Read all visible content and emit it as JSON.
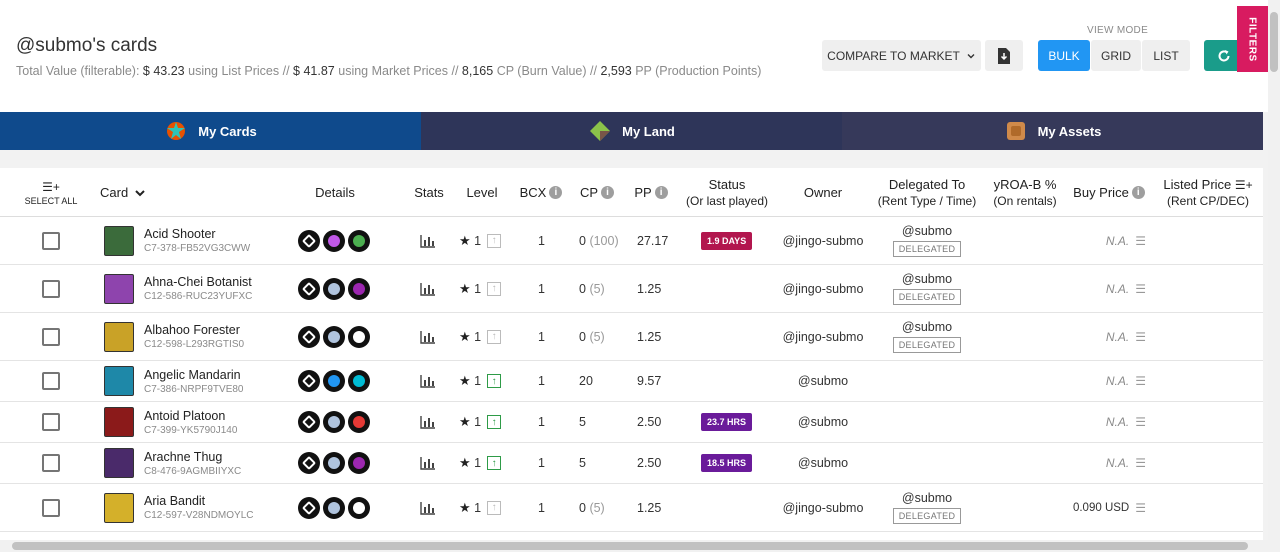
{
  "header": {
    "title": "@submo's cards",
    "summary": {
      "prefix": "Total Value (filterable):",
      "list_value": "$ 43.23",
      "list_suffix": "using List Prices //",
      "market_value": "$ 41.87",
      "market_suffix": "using Market Prices //",
      "cp_value": "8,165",
      "cp_suffix": "CP (Burn Value) //",
      "pp_value": "2,593",
      "pp_suffix": "PP (Production Points)"
    },
    "compare_label": "COMPARE TO MARKET",
    "view_mode_label": "VIEW MODE",
    "view_modes": [
      "BULK",
      "GRID",
      "LIST"
    ],
    "active_view_mode": "BULK",
    "filters_label": "FILTERS"
  },
  "tabs": [
    {
      "label": "My Cards",
      "icon": "cards-icon",
      "active": true
    },
    {
      "label": "My Land",
      "icon": "land-icon",
      "active": false
    },
    {
      "label": "My Assets",
      "icon": "assets-icon",
      "active": false
    }
  ],
  "table": {
    "select_all_label": "SELECT ALL",
    "columns": {
      "card": "Card",
      "details": "Details",
      "stats": "Stats",
      "level": "Level",
      "bcx": "BCX",
      "cp": "CP",
      "pp": "PP",
      "status": "Status",
      "status_sub": "(Or last played)",
      "owner": "Owner",
      "delegated": "Delegated To",
      "delegated_sub": "(Rent Type / Time)",
      "yroa": "yROA-B %",
      "yroa_sub": "(On rentals)",
      "buy_price": "Buy Price",
      "listed_price": "Listed Price",
      "listed_price_sub": "(Rent CP/DEC)"
    },
    "rows": [
      {
        "name": "Acid Shooter",
        "id": "C7-378-FB52VG3CWW",
        "level": "1",
        "bcx": "1",
        "cp": "0",
        "cp_extra": "(100)",
        "pp": "27.17",
        "status": "1.9 DAYS",
        "status_color": "red",
        "owner": "@jingo-submo",
        "delegated_to": "@submo",
        "delegated_label": "DELEGATED",
        "buy_price": "N.A.",
        "listed": "",
        "colors": [
          "#111",
          "#c158e8",
          "#4caf50"
        ],
        "thumb": "#3b6b3b",
        "upgradable": false
      },
      {
        "name": "Ahna-Chei Botanist",
        "id": "C12-586-RUC23YUFXC",
        "level": "1",
        "bcx": "1",
        "cp": "0",
        "cp_extra": "(5)",
        "pp": "1.25",
        "status": "",
        "status_color": "",
        "owner": "@jingo-submo",
        "delegated_to": "@submo",
        "delegated_label": "DELEGATED",
        "buy_price": "N.A.",
        "listed": "",
        "colors": [
          "#111",
          "#b0c4de",
          "#9c27b0"
        ],
        "thumb": "#8e44ad",
        "upgradable": false
      },
      {
        "name": "Albahoo Forester",
        "id": "C12-598-L293RGTIS0",
        "level": "1",
        "bcx": "1",
        "cp": "0",
        "cp_extra": "(5)",
        "pp": "1.25",
        "status": "",
        "status_color": "",
        "owner": "@jingo-submo",
        "delegated_to": "@submo",
        "delegated_label": "DELEGATED",
        "buy_price": "N.A.",
        "listed": "",
        "colors": [
          "#111",
          "#b0c4de",
          "#ffffff"
        ],
        "thumb": "#c9a227",
        "upgradable": false
      },
      {
        "name": "Angelic Mandarin",
        "id": "C7-386-NRPF9TVE80",
        "level": "1",
        "bcx": "1",
        "cp": "20",
        "cp_extra": "",
        "pp": "9.57",
        "status": "",
        "status_color": "",
        "owner": "@submo",
        "delegated_to": "",
        "delegated_label": "",
        "buy_price": "N.A.",
        "listed": "",
        "colors": [
          "#111",
          "#2196f3",
          "#00bcd4"
        ],
        "thumb": "#1e88a8",
        "upgradable": true
      },
      {
        "name": "Antoid Platoon",
        "id": "C7-399-YK5790J140",
        "level": "1",
        "bcx": "1",
        "cp": "5",
        "cp_extra": "",
        "pp": "2.50",
        "status": "23.7 HRS",
        "status_color": "purple",
        "owner": "@submo",
        "delegated_to": "",
        "delegated_label": "",
        "buy_price": "N.A.",
        "listed": "",
        "colors": [
          "#111",
          "#b0c4de",
          "#e53935"
        ],
        "thumb": "#8b1a1a",
        "upgradable": true
      },
      {
        "name": "Arachne Thug",
        "id": "C8-476-9AGMBIIYXC",
        "level": "1",
        "bcx": "1",
        "cp": "5",
        "cp_extra": "",
        "pp": "2.50",
        "status": "18.5 HRS",
        "status_color": "purple",
        "owner": "@submo",
        "delegated_to": "",
        "delegated_label": "",
        "buy_price": "N.A.",
        "listed": "",
        "colors": [
          "#111",
          "#b0c4de",
          "#9c27b0"
        ],
        "thumb": "#4a2a6a",
        "upgradable": true
      },
      {
        "name": "Aria Bandit",
        "id": "C12-597-V28NDMOYLC",
        "level": "1",
        "bcx": "1",
        "cp": "0",
        "cp_extra": "(5)",
        "pp": "1.25",
        "status": "",
        "status_color": "",
        "owner": "@jingo-submo",
        "delegated_to": "@submo",
        "delegated_label": "DELEGATED",
        "buy_price": "",
        "listed": "0.090 USD",
        "colors": [
          "#111",
          "#b0c4de",
          "#ffffff"
        ],
        "thumb": "#d4b02a",
        "upgradable": false
      }
    ]
  }
}
